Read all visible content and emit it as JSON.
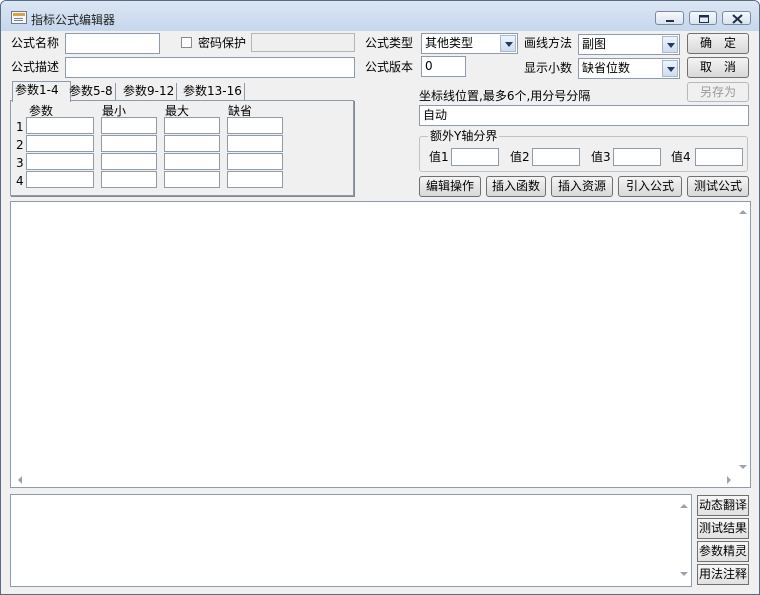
{
  "window": {
    "title": "指标公式编辑器"
  },
  "form": {
    "name_label": "公式名称",
    "name_value": "",
    "password_label": "密码保护",
    "password_value": "",
    "desc_label": "公式描述",
    "desc_value": "",
    "type_label": "公式类型",
    "type_value": "其他类型",
    "version_label": "公式版本",
    "version_value": "0",
    "draw_label": "画线方法",
    "draw_value": "副图",
    "decimal_label": "显示小数",
    "decimal_value": "缺省位数"
  },
  "buttons": {
    "ok": "确　定",
    "cancel": "取　消",
    "save_as": "另存为"
  },
  "params": {
    "tabs": [
      "参数1-4",
      "参数5-8",
      "参数9-12",
      "参数13-16"
    ],
    "headers": [
      "参数",
      "最小",
      "最大",
      "缺省"
    ],
    "rows": [
      "1",
      "2",
      "3",
      "4"
    ]
  },
  "axis": {
    "label": "坐标线位置,最多6个,用分号分隔",
    "value": "自动",
    "group_title": "额外Y轴分界",
    "value_labels": [
      "值1",
      "值2",
      "值3",
      "值4"
    ]
  },
  "toolbar": [
    "编辑操作",
    "插入函数",
    "插入资源",
    "引入公式",
    "测试公式"
  ],
  "side_buttons": [
    "动态翻译",
    "测试结果",
    "参数精灵",
    "用法注释"
  ]
}
